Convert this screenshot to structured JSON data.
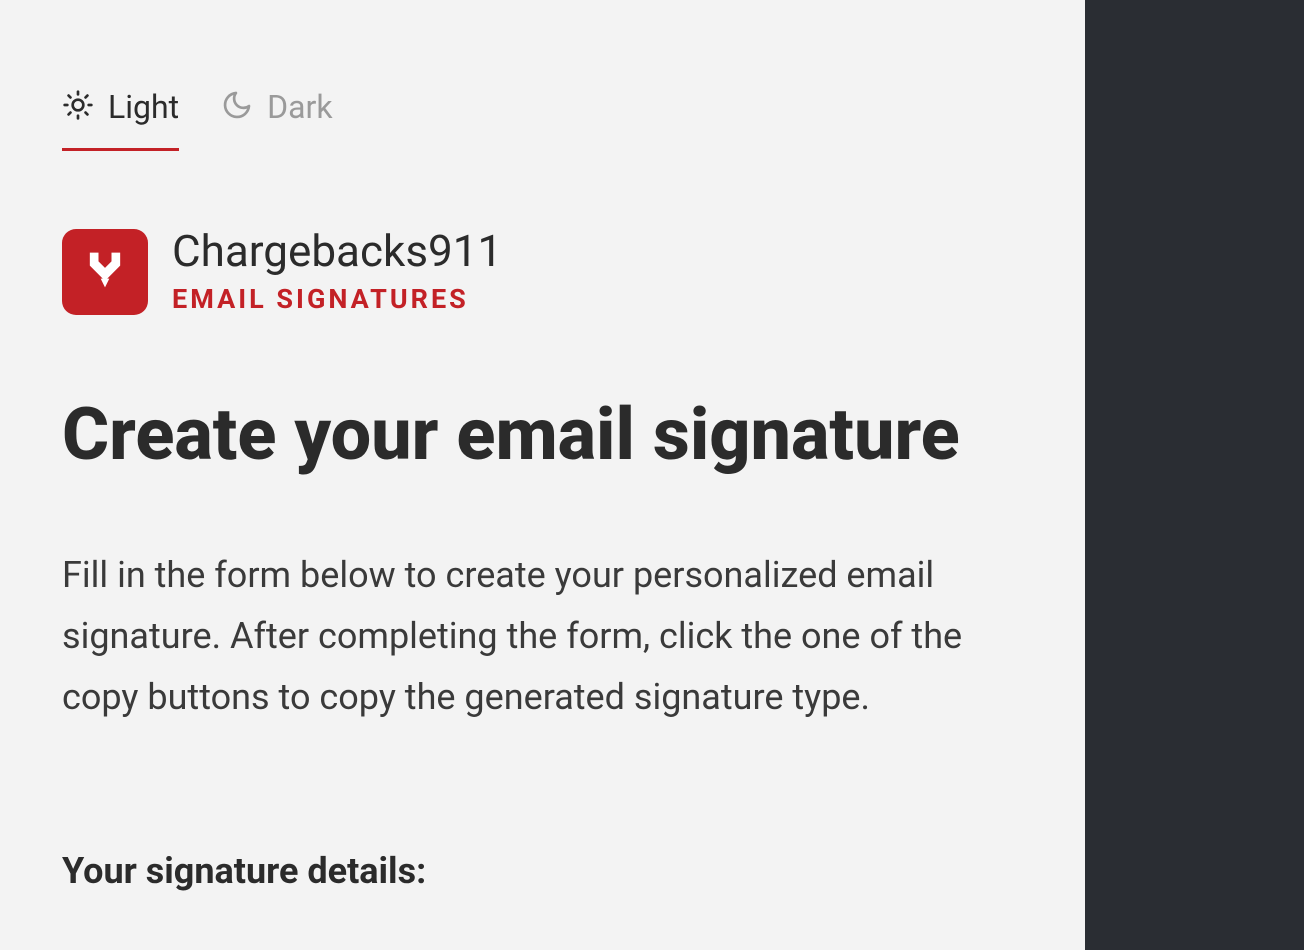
{
  "theme": {
    "light_label": "Light",
    "dark_label": "Dark"
  },
  "brand": {
    "name": "Chargebacks911",
    "subtitle": "EMAIL SIGNATURES"
  },
  "page": {
    "title": "Create your email signature",
    "description": "Fill in the form below to create your personalized email signature. After completing the form, click the one of the copy buttons to copy the generated signature type."
  },
  "form": {
    "section_title": "Your signature details:"
  }
}
